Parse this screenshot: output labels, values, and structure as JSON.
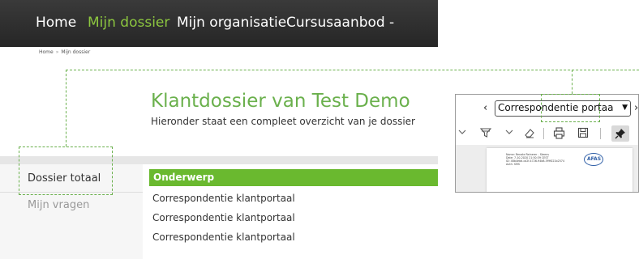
{
  "nav": {
    "home": "Home",
    "dossier": "Mijn dossier",
    "organisatie": "Mijn organisatie",
    "cursus": "Cursusaanbod",
    "more": "-"
  },
  "breadcrumb": {
    "home": "Home",
    "sep": "»",
    "current": "Mijn dossier"
  },
  "page": {
    "title": "Klantdossier van Test Demo",
    "subtitle": "Hieronder staat een compleet overzicht van je dossier"
  },
  "sidebar": {
    "items": [
      {
        "label": "Dossier totaal"
      },
      {
        "label": "Mijn vragen"
      }
    ]
  },
  "table": {
    "header": "Onderwerp",
    "rows": [
      {
        "onderwerp": "Correspondentie klantportaal"
      },
      {
        "onderwerp": "Correspondentie klantportaal"
      },
      {
        "onderwerp": "Correspondentie klantportaal"
      }
    ]
  },
  "viewer": {
    "prev": "‹",
    "select_value": "Correspondentie portaa",
    "next": "›",
    "toolbar_icons": [
      "chevron-down-icon",
      "filter-icon",
      "chevron-down-icon",
      "eraser-icon",
      "print-icon",
      "save-icon",
      "pin-icon"
    ],
    "document_meta": [
      "Name: Renate Reinerer - Steens",
      "Date: 7-10-2020 21:50:39 CEST",
      "ID: 48b4ebd-ca2f-4726-94b8-5f9f021b2574",
      "Auth: SMS"
    ],
    "seal_text": "AFAS"
  },
  "colors": {
    "accent": "#6ab04c",
    "nav_bg": "#2e2e2e",
    "table_header": "#6ab92f"
  }
}
